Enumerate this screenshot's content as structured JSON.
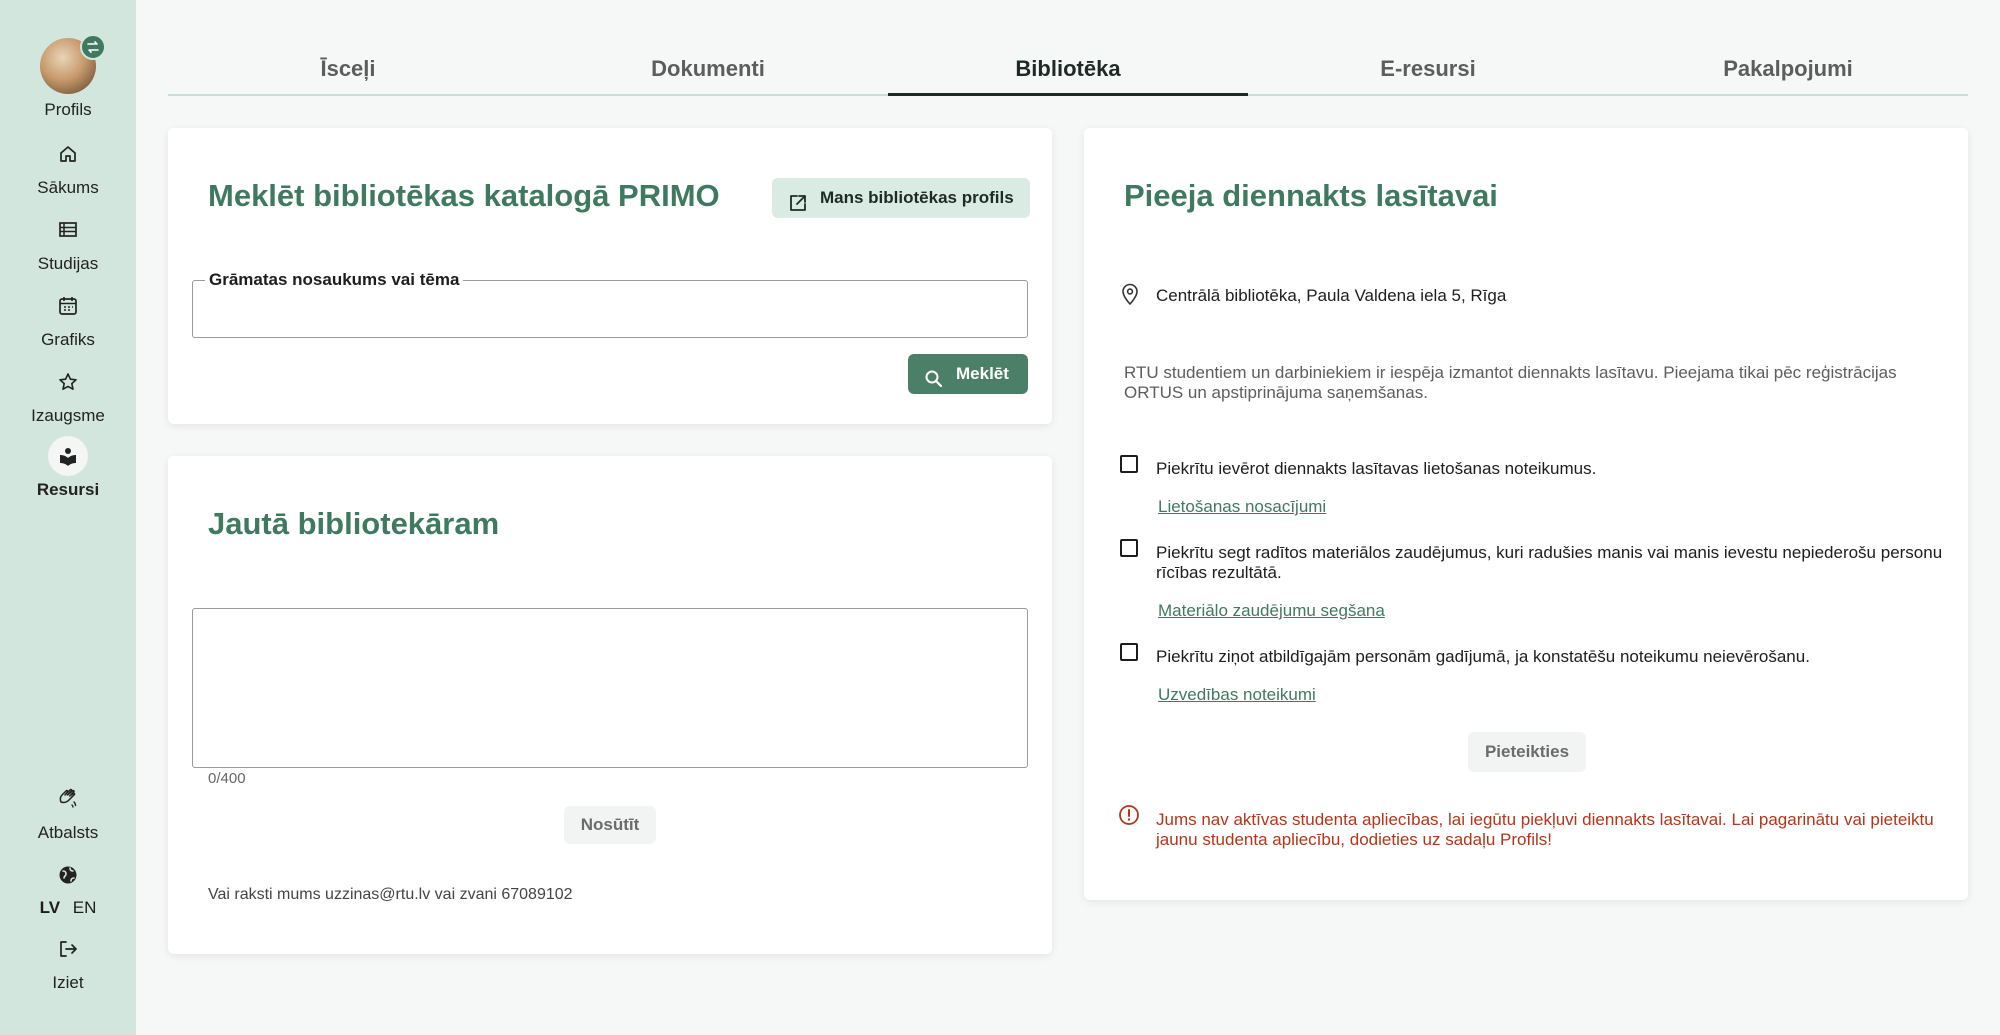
{
  "sidebar": {
    "profile_label": "Profils",
    "items": [
      {
        "label": "Sākums",
        "icon": "home-icon"
      },
      {
        "label": "Studijas",
        "icon": "list-icon"
      },
      {
        "label": "Grafiks",
        "icon": "calendar-icon"
      },
      {
        "label": "Izaugsme",
        "icon": "star-icon"
      },
      {
        "label": "Resursi",
        "icon": "books-icon",
        "active": true
      }
    ],
    "support_label": "Atbalsts",
    "lang_lv": "LV",
    "lang_en": "EN",
    "logout_label": "Iziet"
  },
  "tabs": [
    {
      "label": "Īsceļi"
    },
    {
      "label": "Dokumenti"
    },
    {
      "label": "Bibliotēka",
      "active": true
    },
    {
      "label": "E-resursi"
    },
    {
      "label": "Pakalpojumi"
    }
  ],
  "search_card": {
    "title": "Meklēt bibliotēkas katalogā PRIMO",
    "profile_button": "Mans bibliotēkas profils",
    "field_label": "Grāmatas nosaukums vai tēma",
    "field_value": "",
    "search_button": "Meklēt"
  },
  "ask_card": {
    "title": "Jautā bibliotekāram",
    "textarea_value": "",
    "counter": "0/400",
    "send_button": "Nosūtīt",
    "contact": "Vai raksti mums uzzinas@rtu.lv vai zvani 67089102"
  },
  "access_card": {
    "title": "Pieeja diennakts lasītavai",
    "location": "Centrālā bibliotēka, Paula Valdena iela 5, Rīga",
    "info": "RTU studentiem un darbiniekiem ir iespēja izmantot diennakts lasītavu. Pieejama tikai pēc reģistrācijas ORTUS un apstiprinājuma saņemšanas.",
    "checks": [
      {
        "text": "Piekrītu ievērot diennakts lasītavas lietošanas noteikumus.",
        "link": "Lietošanas nosacījumi",
        "checked": false
      },
      {
        "text": "Piekrītu segt radītos materiālos zaudējumus, kuri radušies manis vai manis ievestu nepiederošu personu rīcības rezultātā.",
        "link": "Materiālo zaudējumu segšana",
        "checked": false
      },
      {
        "text": "Piekrītu ziņot atbildīgajām personām gadījumā, ja konstatēšu noteikumu neievērošanu.",
        "link": "Uzvedības noteikumi",
        "checked": false
      }
    ],
    "apply_button": "Pieteikties",
    "warning": "Jums nav aktīvas studenta apliecības, lai iegūtu piekļuvi diennakts lasītavai. Lai pagarinātu vai pieteiktu jaunu studenta apliecību, dodieties uz sadaļu Profils!"
  },
  "colors": {
    "sidebar": "#d3e6de",
    "accent": "#3f7a60",
    "button_primary": "#4c7f67",
    "warning": "#b3361a"
  }
}
